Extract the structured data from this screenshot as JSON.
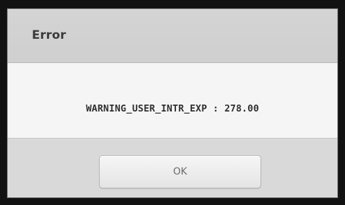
{
  "dialog": {
    "title": "Error",
    "message": "WARNING_USER_INTR_EXP : 278.00",
    "ok_label": "OK"
  },
  "colors": {
    "title_bar": "#d1d1d1",
    "body": "#f5f5f5",
    "footer": "#d9d9d9",
    "frame": "#121212"
  }
}
